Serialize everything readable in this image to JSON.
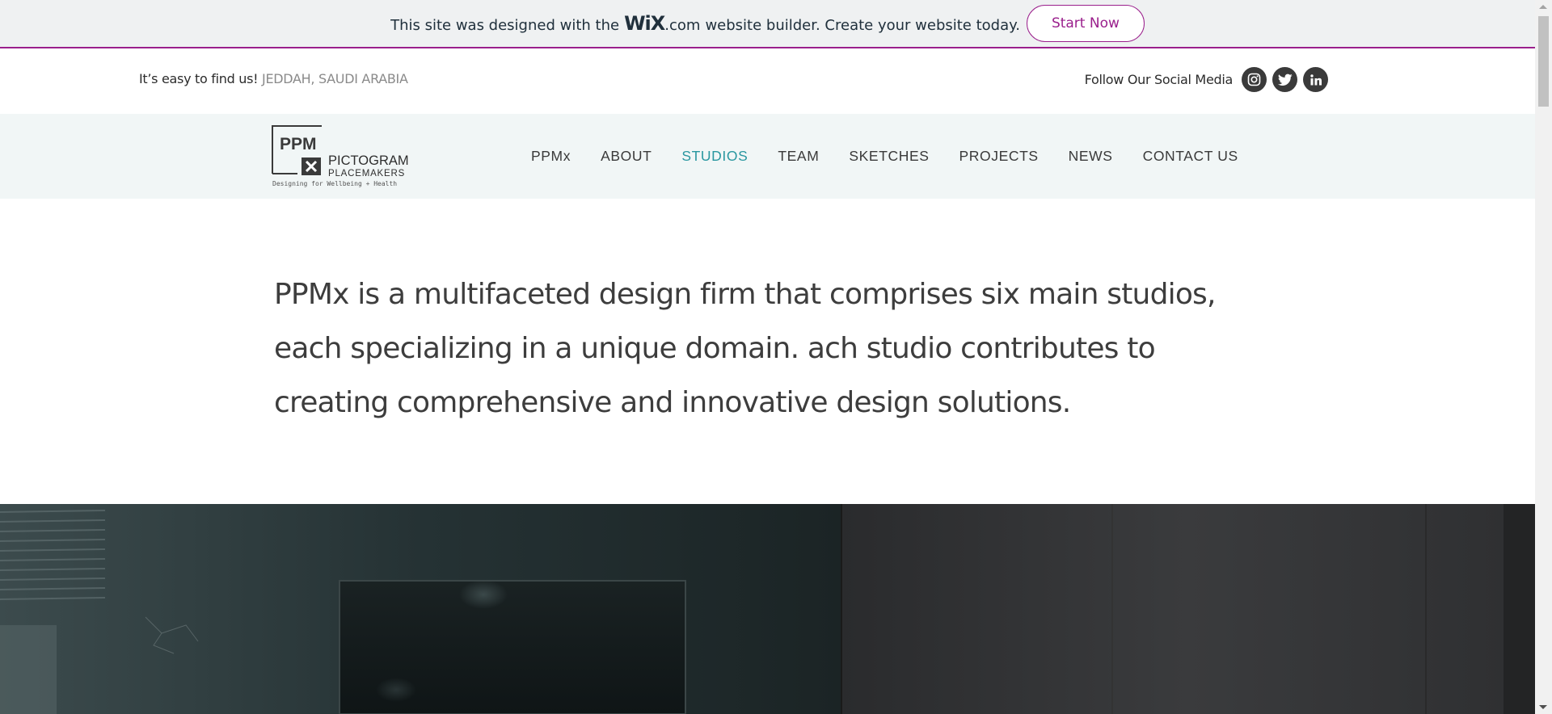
{
  "wix_banner": {
    "text_before": "This site was designed with the",
    "wix_logo": "WiX",
    "dotcom": ".com",
    "text_after": "website builder. Create your website today.",
    "cta_label": "Start Now",
    "accent": "#9a1f8c"
  },
  "info_bar": {
    "find_us_label": "It’s easy to find us!",
    "location": "JEDDAH, SAUDI ARABIA",
    "social_label": "Follow Our Social Media",
    "social_icons": [
      "instagram-icon",
      "twitter-icon",
      "linkedin-icon"
    ]
  },
  "logo": {
    "line1": "PPM",
    "line2": "PICTOGRAM",
    "line3": "PLACEMAKERS",
    "tagline": "Designing for Wellbeing + Health"
  },
  "nav": {
    "items": [
      {
        "label": "PPMx"
      },
      {
        "label": "ABOUT"
      },
      {
        "label": "STUDIOS",
        "active": true
      },
      {
        "label": "TEAM"
      },
      {
        "label": "SKETCHES"
      },
      {
        "label": "PROJECTS"
      },
      {
        "label": "NEWS"
      },
      {
        "label": "CONTACT US"
      }
    ],
    "active_color": "#2a97a0"
  },
  "intro": {
    "text": "PPMx is a multifaceted design firm that comprises six main studios, each specializing in a unique domain. ach studio contributes to creating comprehensive and innovative design solutions."
  }
}
